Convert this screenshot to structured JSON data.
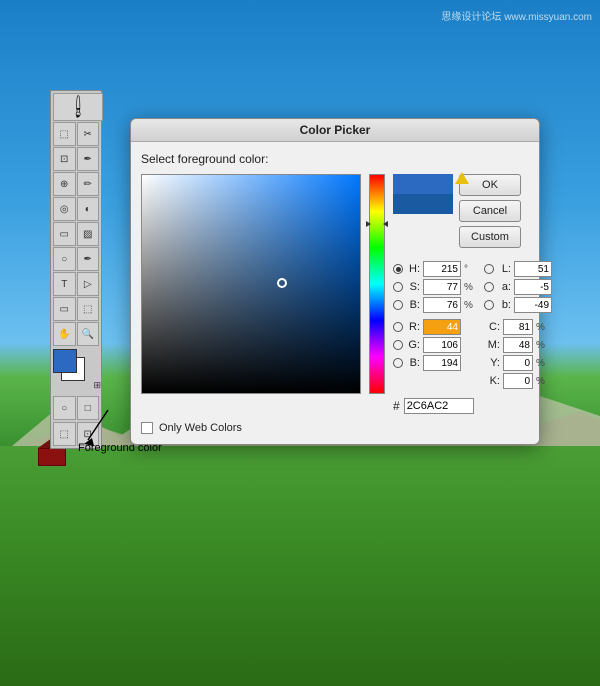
{
  "watermark": "思缘设计论坛 www.missyuan.com",
  "dialog": {
    "title": "Color Picker",
    "label": "Select foreground color:",
    "ok_label": "OK",
    "cancel_label": "Cancel",
    "custom_label": "Custom",
    "only_web_colors_label": "Only Web Colors",
    "values": {
      "H": {
        "value": "215",
        "unit": "°",
        "active": true
      },
      "S": {
        "value": "77",
        "unit": "%"
      },
      "B": {
        "value": "76",
        "unit": "%"
      },
      "L": {
        "value": "51",
        "unit": ""
      },
      "a": {
        "value": "-5",
        "unit": ""
      },
      "b_lab": {
        "value": "-49",
        "unit": ""
      },
      "R": {
        "value": "44",
        "unit": "",
        "highlighted": true
      },
      "G": {
        "value": "106",
        "unit": ""
      },
      "B_rgb": {
        "value": "194",
        "unit": ""
      },
      "C": {
        "value": "81",
        "unit": "%"
      },
      "M": {
        "value": "48",
        "unit": "%"
      },
      "Y": {
        "value": "0",
        "unit": "%"
      },
      "K": {
        "value": "0",
        "unit": "%"
      }
    },
    "hex": "2C6AC2"
  },
  "annotation": {
    "text": "Foreground color"
  },
  "toolbar": {
    "tools": [
      "M",
      "✂",
      "⌘",
      "✏",
      "◻",
      "✒",
      "⬚",
      "⬚",
      "◯",
      "◎",
      "T",
      "⬚",
      "⬚",
      "✋",
      "⌕",
      "⬚",
      "⬚",
      "⬚",
      "⬚",
      "⬚"
    ]
  }
}
